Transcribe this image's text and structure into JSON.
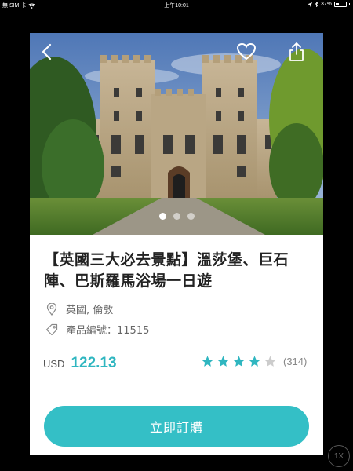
{
  "status_bar": {
    "carrier": "無 SIM 卡",
    "time": "上午10:01",
    "battery": "37%"
  },
  "product": {
    "title": "【英國三大必去景點】溫莎堡、巨石陣、巴斯羅馬浴場一日遊",
    "location": "英國, 倫敦",
    "code": "產品編號：11515",
    "currency": "USD",
    "price": "122.13",
    "rating": 4,
    "rating_max": 5,
    "review_count": "(314)"
  },
  "carousel": {
    "pages": 3,
    "active": 0
  },
  "actions": {
    "buy_label": "立即訂購"
  },
  "zoom": "1X",
  "colors": {
    "accent": "#34bfc6",
    "price": "#2fb6c0",
    "star_on": "#2fb6c0",
    "star_off": "#cccccc"
  },
  "icons": {
    "back": "chevron-left-icon",
    "favorite": "heart-outline-icon",
    "share": "share-icon",
    "location": "map-pin-icon",
    "code": "tag-icon"
  }
}
